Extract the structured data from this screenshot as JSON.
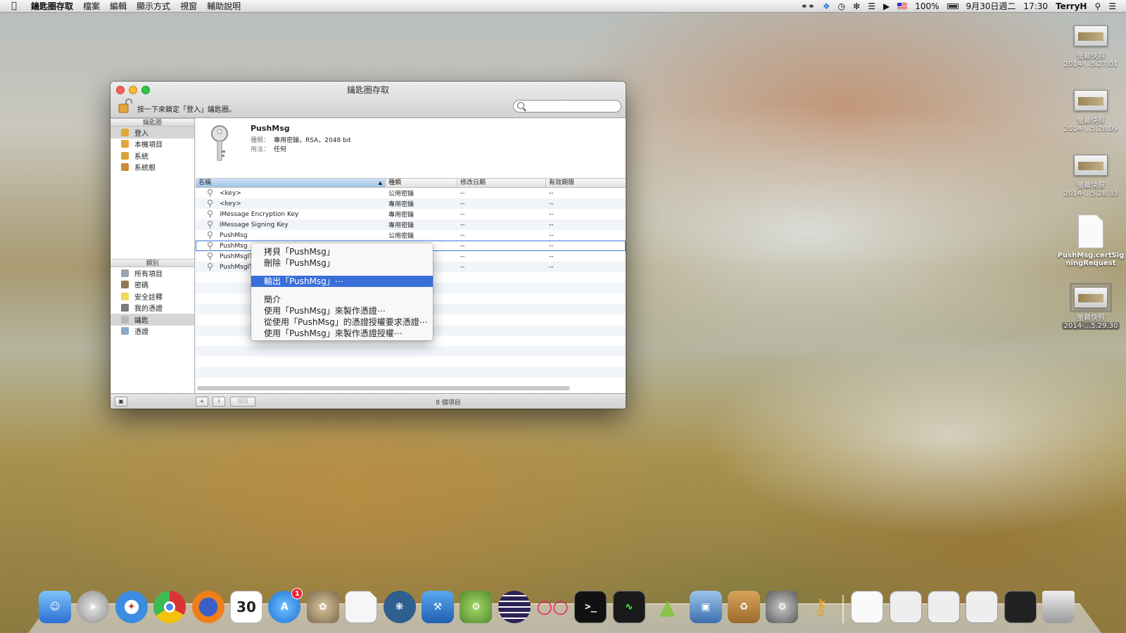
{
  "menubar": {
    "app_name": "鑰匙圈存取",
    "menus": [
      "檔案",
      "編輯",
      "顯示方式",
      "視窗",
      "輔助說明"
    ],
    "battery": "100%",
    "date": "9月30日週二",
    "time": "17:30",
    "user": "TerryH"
  },
  "window": {
    "title": "鑰匙圈存取",
    "lock_hint": "按一下來鎖定「登入」鑰匙圈。",
    "search_placeholder": ""
  },
  "sidebar": {
    "keychains_header": "鑰匙圈",
    "keychains": [
      {
        "label": "登入",
        "icon": "unlocked-keychain-icon"
      },
      {
        "label": "本機項目",
        "icon": "unlocked-keychain-icon"
      },
      {
        "label": "系統",
        "icon": "locked-keychain-icon"
      },
      {
        "label": "系統根",
        "icon": "folder-icon"
      }
    ],
    "categories_header": "類別",
    "categories": [
      {
        "label": "所有項目",
        "icon": "people-icon"
      },
      {
        "label": "密碼",
        "icon": "pen-icon"
      },
      {
        "label": "安全註釋",
        "icon": "note-icon"
      },
      {
        "label": "我的憑證",
        "icon": "certificate-icon"
      },
      {
        "label": "鑰匙",
        "icon": "key-icon"
      },
      {
        "label": "憑證",
        "icon": "certificate-icon"
      }
    ]
  },
  "detail": {
    "name": "PushMsg",
    "kind_label": "種類：",
    "kind_value": "專用密鑰，RSA，2048 bit",
    "usage_label": "用法：",
    "usage_value": "任何"
  },
  "table": {
    "columns": [
      "名稱",
      "種類",
      "修改日期",
      "有效期限"
    ],
    "rows": [
      {
        "name": "<key>",
        "kind": "公用密鑰",
        "date": "--",
        "expiry": "--"
      },
      {
        "name": "<key>",
        "kind": "專用密鑰",
        "date": "--",
        "expiry": "--"
      },
      {
        "name": "iMessage Encryption Key",
        "kind": "專用密鑰",
        "date": "--",
        "expiry": "--"
      },
      {
        "name": "iMessage Signing Key",
        "kind": "專用密鑰",
        "date": "--",
        "expiry": "--"
      },
      {
        "name": "PushMsg",
        "kind": "公用密鑰",
        "date": "--",
        "expiry": "--"
      },
      {
        "name": "PushMsg",
        "kind": "",
        "date": "--",
        "expiry": "--"
      },
      {
        "name": "PushMsgIT",
        "kind": "",
        "date": "--",
        "expiry": "--"
      },
      {
        "name": "PushMsgIT",
        "kind": "",
        "date": "--",
        "expiry": "--"
      }
    ],
    "item_count": "8 個項目"
  },
  "bottombar": {
    "add_label": "+",
    "info_label": "i",
    "item_btn_label": "項目"
  },
  "context_menu": {
    "copy": "拷貝「PushMsg」",
    "delete": "刪除「PushMsg」",
    "export": "輸出「PushMsg」⋯",
    "get_info": "簡介",
    "create_cert": "使用「PushMsg」來製作憑證⋯",
    "request_cert": "從使用「PushMsg」的憑證授權要求憑證⋯",
    "create_ca": "使用「PushMsg」來製作憑證授權⋯"
  },
  "desktop_icons": [
    {
      "line1": "螢幕快照",
      "line2": "2014-...5.27.01",
      "kind": "screenshot"
    },
    {
      "line1": "螢幕快照",
      "line2": "2014-...5.28.09",
      "kind": "screenshot"
    },
    {
      "line1": "螢幕快照",
      "line2": "2014-...5.28.33",
      "kind": "screenshot"
    },
    {
      "line1": "PushMsg.certSig",
      "line2": "ningRequest",
      "kind": "document"
    },
    {
      "line1": "螢幕快照",
      "line2": "2014-...5.29.30",
      "kind": "screenshot"
    }
  ],
  "dock": {
    "calendar_day": "30",
    "appstore_badge": "1",
    "apps": [
      "finder",
      "launchpad",
      "safari",
      "chrome",
      "firefox",
      "calendar",
      "app-store",
      "gimp",
      "textedit",
      "sourcetree",
      "xcode",
      "android-tool",
      "eclipse",
      "flickr",
      "terminal",
      "activity-monitor",
      "android",
      "virtualbox",
      "archive-utility",
      "system-preferences",
      "keychain-access"
    ]
  },
  "colors": {
    "selection_blue": "#3a6fd8",
    "table_stripe": "#f1f5fa",
    "accent_focus": "#3a78d6"
  }
}
